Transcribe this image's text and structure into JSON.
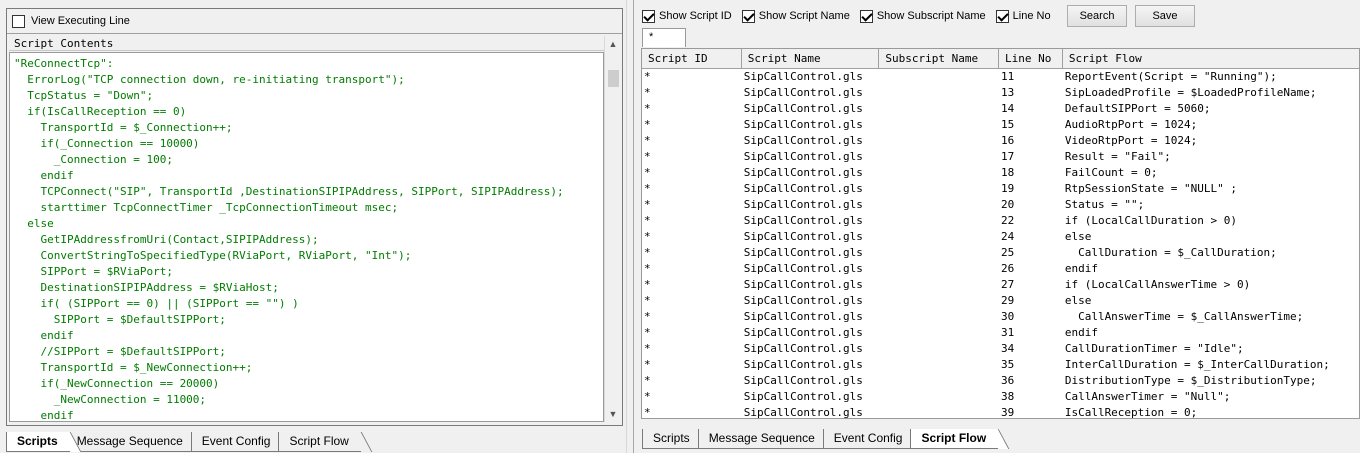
{
  "left": {
    "view_executing_line": "View Executing Line",
    "script_contents_label": "Script Contents",
    "code_lines": [
      "\"ReConnectTcp\":",
      "  ErrorLog(\"TCP connection down, re-initiating transport\");",
      "  TcpStatus = \"Down\";",
      "  if(IsCallReception == 0)",
      "    TransportId = $_Connection++;",
      "    if(_Connection == 10000)",
      "      _Connection = 100;",
      "    endif",
      "    TCPConnect(\"SIP\", TransportId ,DestinationSIPIPAddress, SIPPort, SIPIPAddress);",
      "    starttimer TcpConnectTimer _TcpConnectionTimeout msec;",
      "  else",
      "    GetIPAddressfromUri(Contact,SIPIPAddress);",
      "    ConvertStringToSpecifiedType(RViaPort, RViaPort, \"Int\");",
      "    SIPPort = $RViaPort;",
      "    DestinationSIPIPAddress = $RViaHost;",
      "    if( (SIPPort == 0) || (SIPPort == \"\") )",
      "      SIPPort = $DefaultSIPPort;",
      "    endif",
      "    //SIPPort = $DefaultSIPPort;",
      "    TransportId = $_NewConnection++;",
      "    if(_NewConnection == 20000)",
      "      _NewConnection = 11000;",
      "    endif"
    ],
    "tabs": [
      "Scripts",
      "Message Sequence",
      "Event Config",
      "Script Flow"
    ],
    "active_tab": "Scripts"
  },
  "right": {
    "toolbar": {
      "show_script_id": "Show Script ID",
      "show_script_name": "Show Script Name",
      "show_subscript_name": "Show Subscript Name",
      "line_no": "Line No",
      "search": "Search",
      "save": "Save"
    },
    "sub_tab": "*",
    "columns": [
      "Script ID",
      "Script Name",
      "Subscript Name",
      "Line No",
      "Script Flow"
    ],
    "rows": [
      [
        "*",
        "SipCallControl.gls",
        "",
        "11",
        "ReportEvent(Script = \"Running\");"
      ],
      [
        "*",
        "SipCallControl.gls",
        "",
        "13",
        "SipLoadedProfile = $LoadedProfileName;"
      ],
      [
        "*",
        "SipCallControl.gls",
        "",
        "14",
        "DefaultSIPPort = 5060;"
      ],
      [
        "*",
        "SipCallControl.gls",
        "",
        "15",
        "AudioRtpPort = 1024;"
      ],
      [
        "*",
        "SipCallControl.gls",
        "",
        "16",
        "VideoRtpPort = 1024;"
      ],
      [
        "*",
        "SipCallControl.gls",
        "",
        "17",
        "Result = \"Fail\";"
      ],
      [
        "*",
        "SipCallControl.gls",
        "",
        "18",
        "FailCount = 0;"
      ],
      [
        "*",
        "SipCallControl.gls",
        "",
        "19",
        "RtpSessionState = \"NULL\" ;"
      ],
      [
        "*",
        "SipCallControl.gls",
        "",
        "20",
        "Status = \"\";"
      ],
      [
        "*",
        "SipCallControl.gls",
        "",
        "22",
        "if (LocalCallDuration > 0)"
      ],
      [
        "*",
        "SipCallControl.gls",
        "",
        "24",
        "else"
      ],
      [
        "*",
        "SipCallControl.gls",
        "",
        "25",
        "  CallDuration = $_CallDuration;"
      ],
      [
        "*",
        "SipCallControl.gls",
        "",
        "26",
        "endif"
      ],
      [
        "*",
        "SipCallControl.gls",
        "",
        "27",
        "if (LocalCallAnswerTime > 0)"
      ],
      [
        "*",
        "SipCallControl.gls",
        "",
        "29",
        "else"
      ],
      [
        "*",
        "SipCallControl.gls",
        "",
        "30",
        "  CallAnswerTime = $_CallAnswerTime;"
      ],
      [
        "*",
        "SipCallControl.gls",
        "",
        "31",
        "endif"
      ],
      [
        "*",
        "SipCallControl.gls",
        "",
        "34",
        "CallDurationTimer = \"Idle\";"
      ],
      [
        "*",
        "SipCallControl.gls",
        "",
        "35",
        "InterCallDuration = $_InterCallDuration;"
      ],
      [
        "*",
        "SipCallControl.gls",
        "",
        "36",
        "DistributionType = $_DistributionType;"
      ],
      [
        "*",
        "SipCallControl.gls",
        "",
        "38",
        "CallAnswerTimer = \"Null\";"
      ],
      [
        "*",
        "SipCallControl.gls",
        "",
        "39",
        "IsCallReception = 0;"
      ]
    ],
    "tabs": [
      "Scripts",
      "Message Sequence",
      "Event Config",
      "Script Flow"
    ],
    "active_tab": "Script Flow"
  }
}
